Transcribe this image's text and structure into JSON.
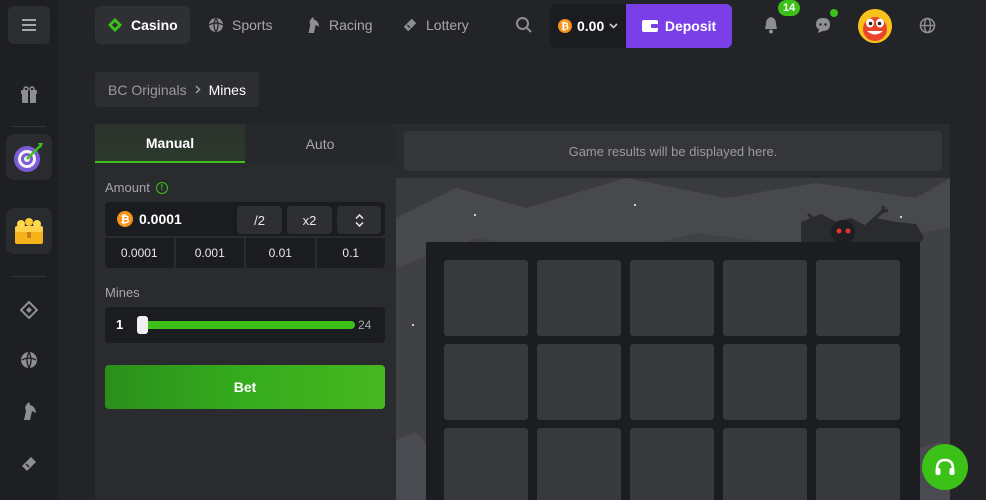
{
  "nav": {
    "casino": "Casino",
    "sports": "Sports",
    "racing": "Racing",
    "lottery": "Lottery"
  },
  "wallet": {
    "balance": "0.00",
    "deposit_label": "Deposit"
  },
  "notifications": {
    "count": "14"
  },
  "breadcrumb": {
    "parent": "BC Originals",
    "current": "Mines"
  },
  "bet_panel": {
    "tabs": [
      "Manual",
      "Auto"
    ],
    "active_tab": "Manual",
    "amount_label": "Amount",
    "amount_value": "0.0001",
    "half_label": "/2",
    "double_label": "x2",
    "quick_amounts": [
      "0.0001",
      "0.001",
      "0.01",
      "0.1"
    ],
    "mines_label": "Mines",
    "mines_value": "1",
    "mines_max": "24",
    "bet_label": "Bet"
  },
  "game": {
    "results_placeholder": "Game results will be displayed here."
  },
  "colors": {
    "accent_green": "#3bc117",
    "deposit_purple": "#7b3fe8",
    "bitcoin_orange": "#f7931a"
  },
  "icons": {
    "menu": "hamburger-icon",
    "casino": "casino-diamond-icon",
    "search": "search-icon",
    "bell": "bell-icon",
    "chat": "chat-icon",
    "globe": "globe-icon",
    "support": "headset-icon"
  }
}
